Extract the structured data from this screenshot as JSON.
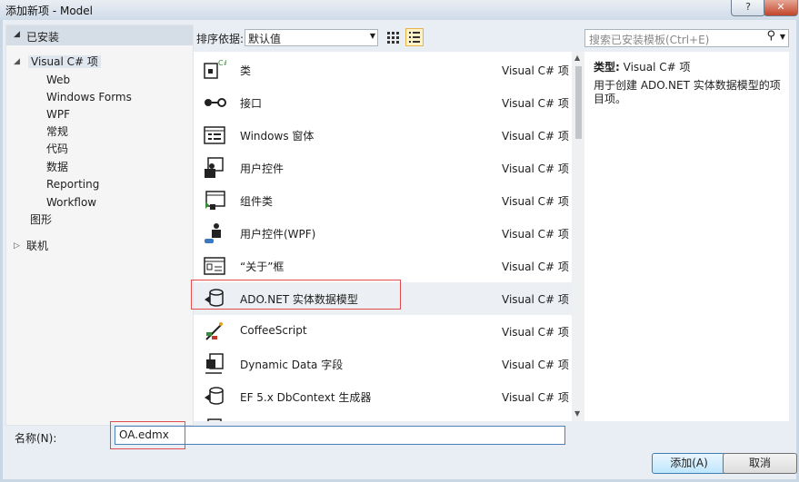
{
  "window": {
    "title": "添加新项 - Model",
    "help_btn": "?",
    "close_btn": "✕"
  },
  "tree": {
    "header": "已安装",
    "root": "Visual C# 项",
    "children": [
      "Web",
      "Windows Forms",
      "WPF",
      "常规",
      "代码",
      "数据",
      "Reporting",
      "Workflow"
    ],
    "graphics": "图形",
    "online": "联机"
  },
  "toolbar": {
    "sort_label": "排序依据:",
    "sort_value": "默认值"
  },
  "templates": [
    {
      "name": "类",
      "category": "Visual C# 项",
      "icon": "class-icon"
    },
    {
      "name": "接口",
      "category": "Visual C# 项",
      "icon": "interface-icon"
    },
    {
      "name": "Windows 窗体",
      "category": "Visual C# 项",
      "icon": "windows-form-icon"
    },
    {
      "name": "用户控件",
      "category": "Visual C# 项",
      "icon": "user-control-icon"
    },
    {
      "name": "组件类",
      "category": "Visual C# 项",
      "icon": "component-class-icon"
    },
    {
      "name": "用户控件(WPF)",
      "category": "Visual C# 项",
      "icon": "wpf-user-control-icon"
    },
    {
      "name": "“关于”框",
      "category": "Visual C# 项",
      "icon": "about-box-icon"
    },
    {
      "name": "ADO.NET 实体数据模型",
      "category": "Visual C# 项",
      "icon": "entity-model-icon"
    },
    {
      "name": "CoffeeScript",
      "category": "Visual C# 项",
      "icon": "coffeescript-icon"
    },
    {
      "name": "Dynamic Data 字段",
      "category": "Visual C# 项",
      "icon": "dynamic-data-icon"
    },
    {
      "name": "EF 5.x DbContext 生成器",
      "category": "Visual C# 项",
      "icon": "dbcontext-generator-icon"
    }
  ],
  "search": {
    "placeholder": "搜索已安装模板(Ctrl+E)"
  },
  "details": {
    "type_label": "类型:",
    "type_value": "Visual C# 项",
    "description": "用于创建 ADO.NET 实体数据模型的项目项。"
  },
  "bottom": {
    "name_label": "名称(N):",
    "name_value": "OA.edmx",
    "add_button": "添加(A)",
    "cancel_button": "取消"
  },
  "colors": {
    "highlight_border": "#e24b4b",
    "selected_row": "#eceff3"
  }
}
